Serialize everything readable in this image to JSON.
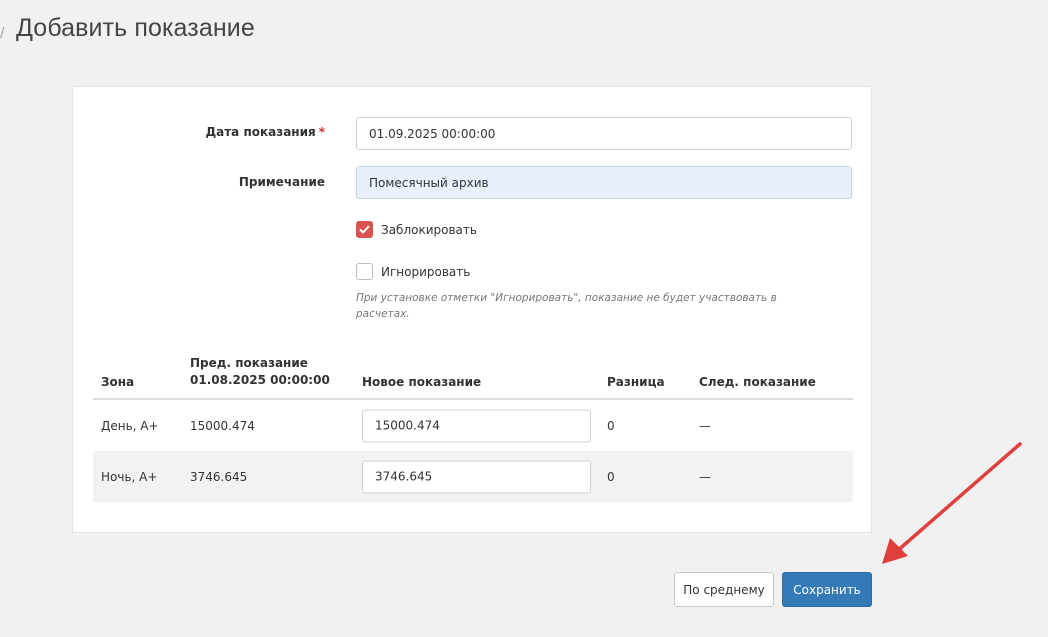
{
  "header": {
    "crumb_mark": "/",
    "title": "Добавить показание"
  },
  "form": {
    "date_label": "Дата показания",
    "required_mark": "*",
    "date_value": "01.09.2025 00:00:00",
    "note_label": "Примечание",
    "note_value": "Помесячный архив",
    "lock_label": "Заблокировать",
    "lock_checked": true,
    "ignore_label": "Игнорировать",
    "ignore_checked": false,
    "hint": "При установке отметки \"Игнорировать\", показание не будет участвовать в расчетах."
  },
  "table": {
    "headers": {
      "zone": "Зона",
      "prev_line1": "Пред. показание",
      "prev_line2": "01.08.2025 00:00:00",
      "new": "Новое показание",
      "diff": "Разница",
      "next": "След. показание"
    },
    "rows": [
      {
        "zone": "День, А+",
        "prev": "15000.474",
        "new": "15000.474",
        "diff": "0",
        "next": "—"
      },
      {
        "zone": "Ночь, А+",
        "prev": "3746.645",
        "new": "3746.645",
        "diff": "0",
        "next": "—"
      }
    ]
  },
  "buttons": {
    "average_label": "По среднему",
    "save_label": "Сохранить"
  },
  "colors": {
    "accent": "#337ab7",
    "checkbox_checked": "#d9534f",
    "annotation_arrow": "#e0403c"
  },
  "icons": {
    "check": "check-icon",
    "arrow": "annotation-arrow"
  }
}
